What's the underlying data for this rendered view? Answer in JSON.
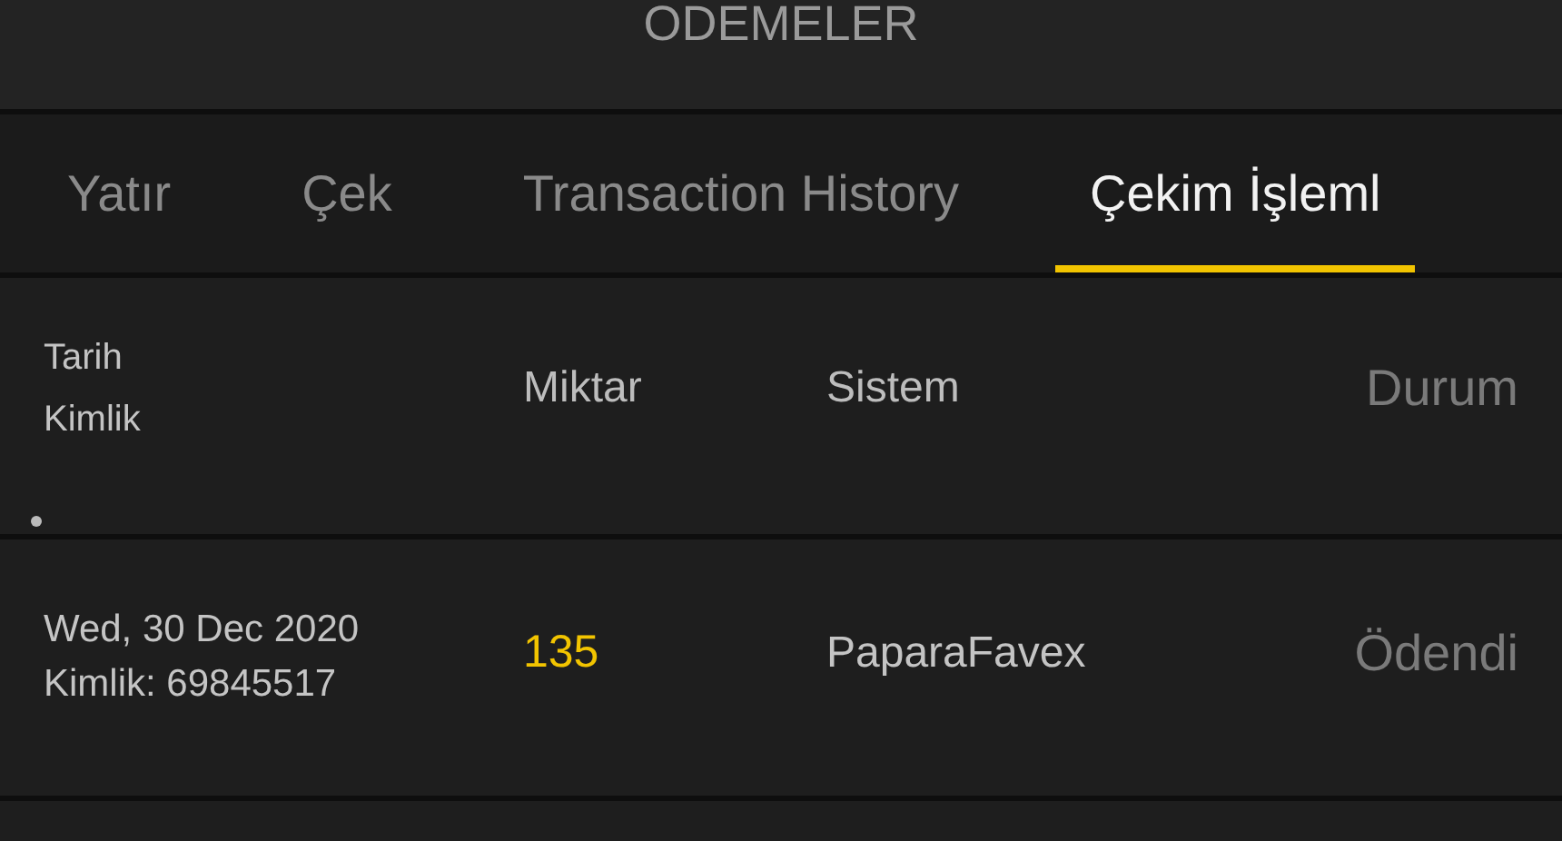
{
  "header": {
    "title": "ODEMELER"
  },
  "tabs": [
    {
      "label": "Yatır",
      "selected": false
    },
    {
      "label": "Çek",
      "selected": false
    },
    {
      "label": "Transaction History",
      "selected": false
    },
    {
      "label": "Çekim İşleml",
      "selected": true
    }
  ],
  "table": {
    "columns": [
      {
        "lines": [
          "Tarih",
          "Kimlik"
        ]
      },
      {
        "lines": [
          "Miktar"
        ]
      },
      {
        "lines": [
          "Sistem"
        ]
      },
      {
        "lines": [
          "Durum"
        ]
      }
    ],
    "rows": [
      {
        "date": "Wed, 30 Dec 2020",
        "id": "Kimlik: 69845517",
        "amount": "135",
        "system": "PaparaFavex",
        "status": "Ödendi"
      }
    ]
  }
}
